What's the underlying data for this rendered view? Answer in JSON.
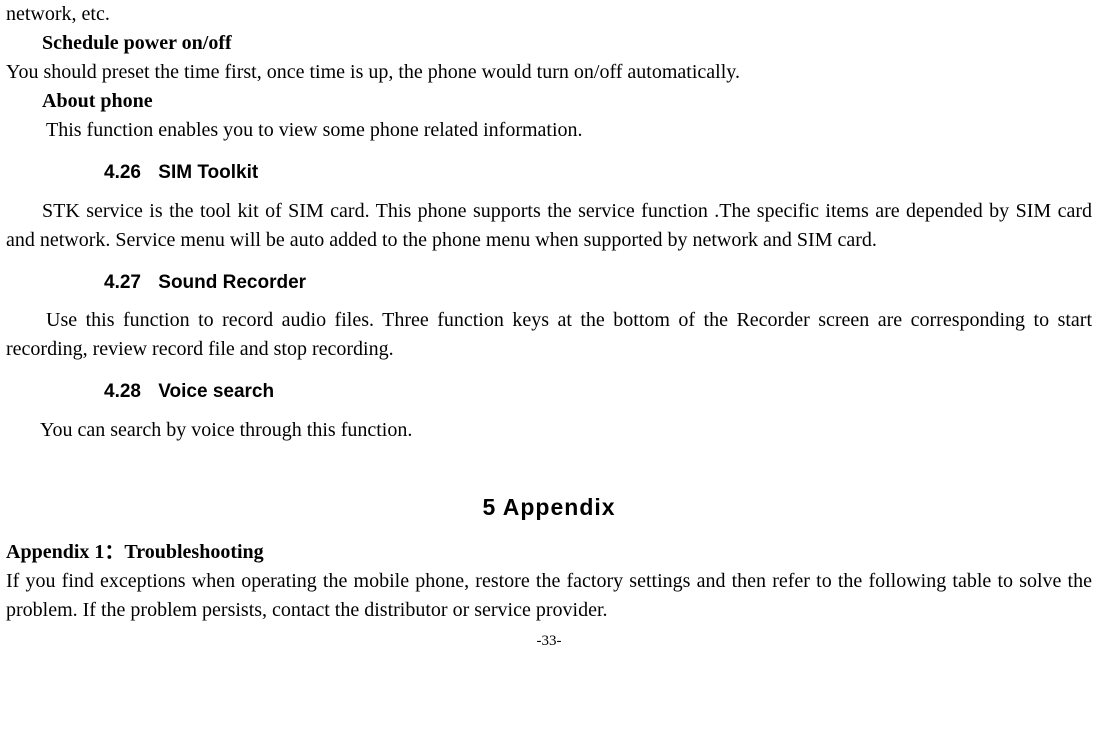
{
  "top_fragment": "network, etc.",
  "schedule_head": "Schedule power on/off",
  "schedule_body": "You should preset the time first, once time is up, the phone would turn on/off automatically.",
  "about_head": "About phone",
  "about_body": "This function enables you to view some phone related information.",
  "sections": [
    {
      "num": "4.26",
      "title": "SIM Toolkit",
      "body": "STK service is the tool kit of SIM card. This phone supports the service function .The specific items are depended by SIM card and network. Service menu will be auto added to the phone menu when supported by network and SIM card."
    },
    {
      "num": "4.27",
      "title": "Sound Recorder",
      "body": "Use this function to record audio files. Three function keys at the bottom of the Recorder screen are corresponding to start recording, review record file and stop recording."
    },
    {
      "num": "4.28",
      "title": "Voice search",
      "body": "You can search by voice through this function."
    }
  ],
  "chapter": "5 Appendix",
  "appendix_head": "Appendix 1：Troubleshooting",
  "appendix_body": "If you find exceptions when operating the mobile phone, restore the factory settings and then refer to the following table to solve the problem. If the problem persists, contact the distributor or service provider.",
  "footer": "-33-"
}
